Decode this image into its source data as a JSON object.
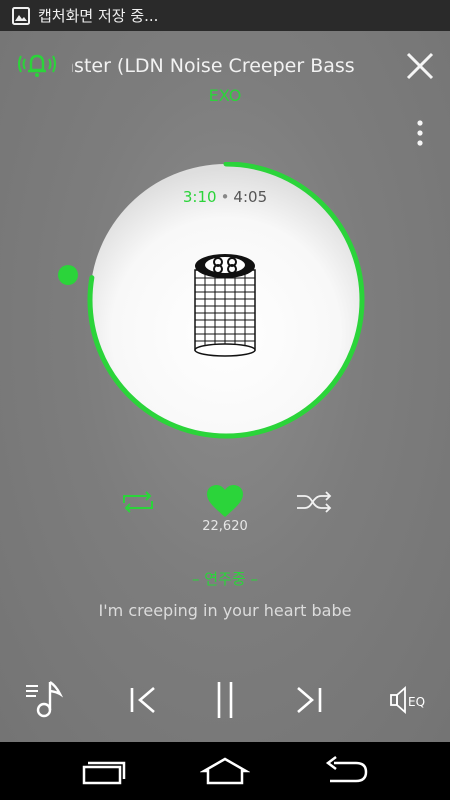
{
  "status_bar": {
    "text": "캡처화면 저장 중..."
  },
  "player": {
    "title": "nster (LDN Noise Creeper Bass",
    "artist": "EXO",
    "time_current": "3:10",
    "time_separator": "•",
    "time_total": "4:05",
    "progress_fraction": 0.776,
    "like_count": "22,620",
    "playing_label": "– 연주중 –",
    "lyric": "I'm creeping in your heart babe",
    "eq_label": "EQ"
  },
  "colors": {
    "accent": "#2bd43a",
    "background": "#7b7b7b",
    "disc": "#ffffff"
  }
}
